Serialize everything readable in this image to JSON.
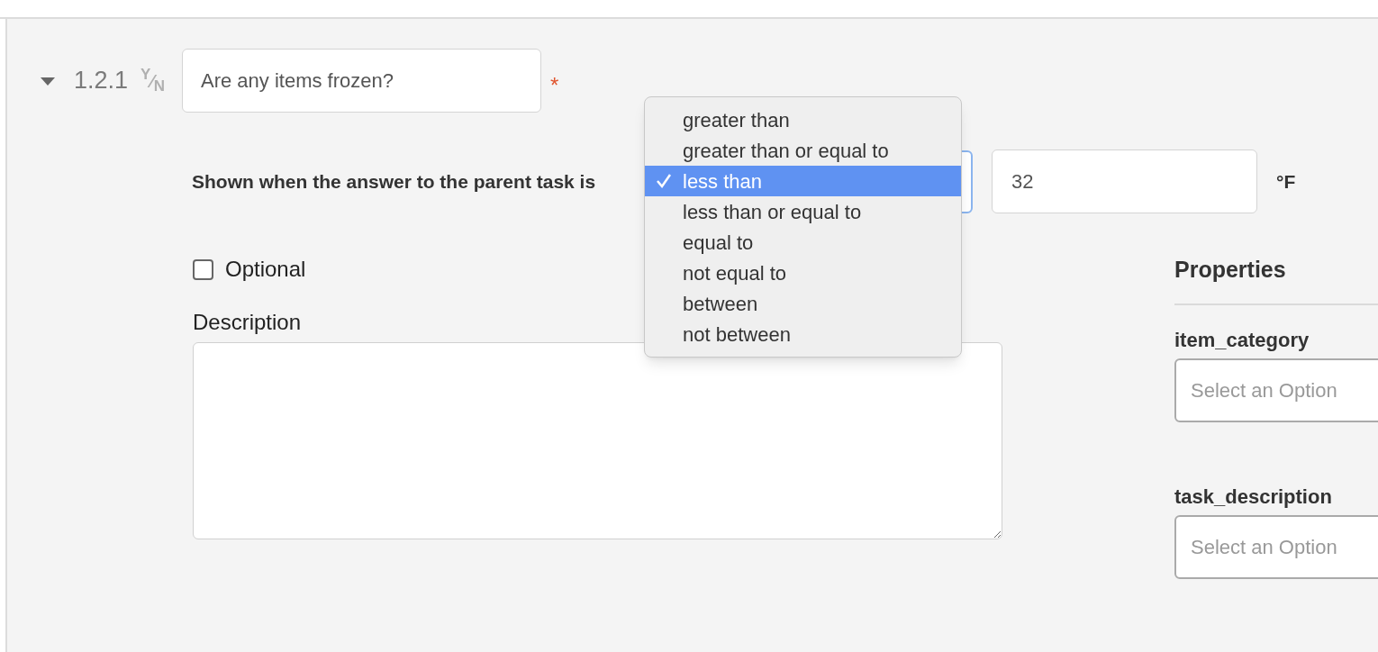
{
  "task": {
    "expanded": true,
    "number": "1.2.1",
    "answer_type": "$^{Y}$⁄$_{N}$",
    "question": "Are any items frozen?",
    "required_mark": "*"
  },
  "condition": {
    "label": "Shown when the answer to the parent task is",
    "menu_open": true,
    "operators": [
      {
        "label": "greater than",
        "selected": false
      },
      {
        "label": "greater than or equal to",
        "selected": false
      },
      {
        "label": "less than",
        "selected": true
      },
      {
        "label": "less than or equal to",
        "selected": false
      },
      {
        "label": "equal to",
        "selected": false
      },
      {
        "label": "not equal to",
        "selected": false
      },
      {
        "label": "between",
        "selected": false
      },
      {
        "label": "not between",
        "selected": false
      }
    ],
    "value": "32",
    "unit": "°F"
  },
  "optional": {
    "label": "Optional",
    "checked": false
  },
  "description": {
    "label": "Description"
  },
  "properties": {
    "title": "Properties",
    "fields": [
      {
        "name": "item_category",
        "placeholder": "Select an Option"
      },
      {
        "name": "task_description",
        "placeholder": "Select an Option"
      }
    ]
  }
}
